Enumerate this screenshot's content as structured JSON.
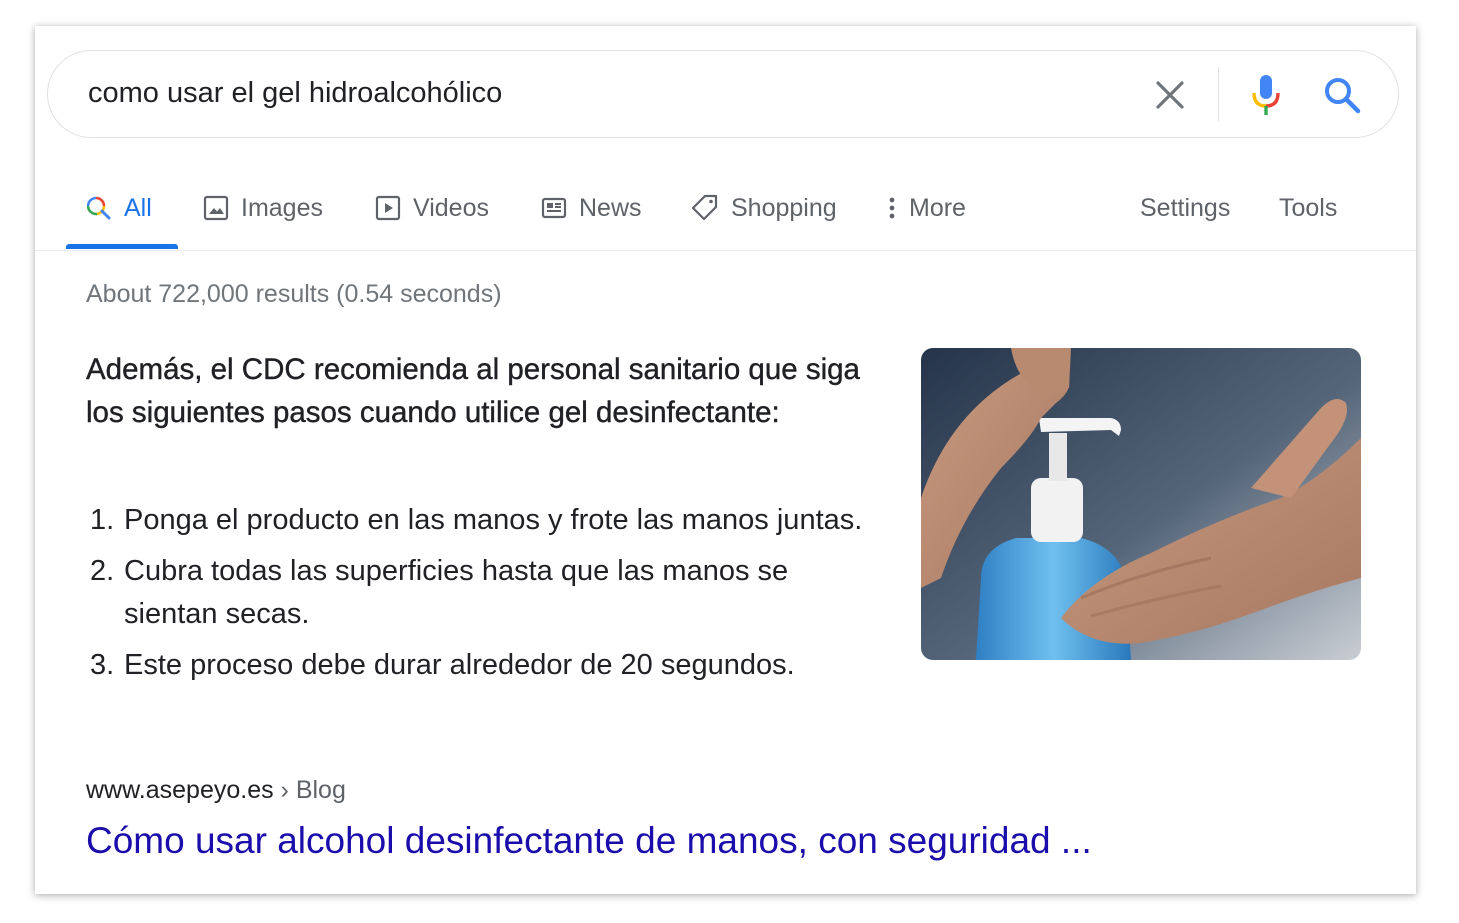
{
  "search": {
    "query": "como usar el gel hidroalcohólico"
  },
  "tabs": [
    {
      "label": "All",
      "icon": "search-icon",
      "active": true
    },
    {
      "label": "Images",
      "icon": "image-icon"
    },
    {
      "label": "Videos",
      "icon": "play-icon"
    },
    {
      "label": "News",
      "icon": "newspaper-icon"
    },
    {
      "label": "Shopping",
      "icon": "tag-icon"
    },
    {
      "label": "More",
      "icon": "more-vertical-icon"
    }
  ],
  "tools": {
    "settings_label": "Settings",
    "tools_label": "Tools"
  },
  "result_stats": "About 722,000 results (0.54 seconds)",
  "featured_snippet": {
    "heading": "Además, el CDC recomienda al personal sanitario que siga los siguientes pasos cuando utilice gel desinfectante:",
    "steps": [
      {
        "num": "1.",
        "text": "Ponga el producto en las manos y frote las manos juntas."
      },
      {
        "num": "2.",
        "text": "Cubra todas las superficies hasta que las manos se sientan secas."
      },
      {
        "num": "3.",
        "text": "Este proceso debe durar alrededor de 20 segundos."
      }
    ],
    "source_domain": "www.asepeyo.es",
    "source_breadcrumb": " › Blog",
    "link_title": "Cómo usar alcohol desinfectante de manos, con seguridad ..."
  },
  "colors": {
    "accent": "#1a73e8",
    "link": "#1a0dab",
    "text": "#202124",
    "muted": "#70757a"
  }
}
